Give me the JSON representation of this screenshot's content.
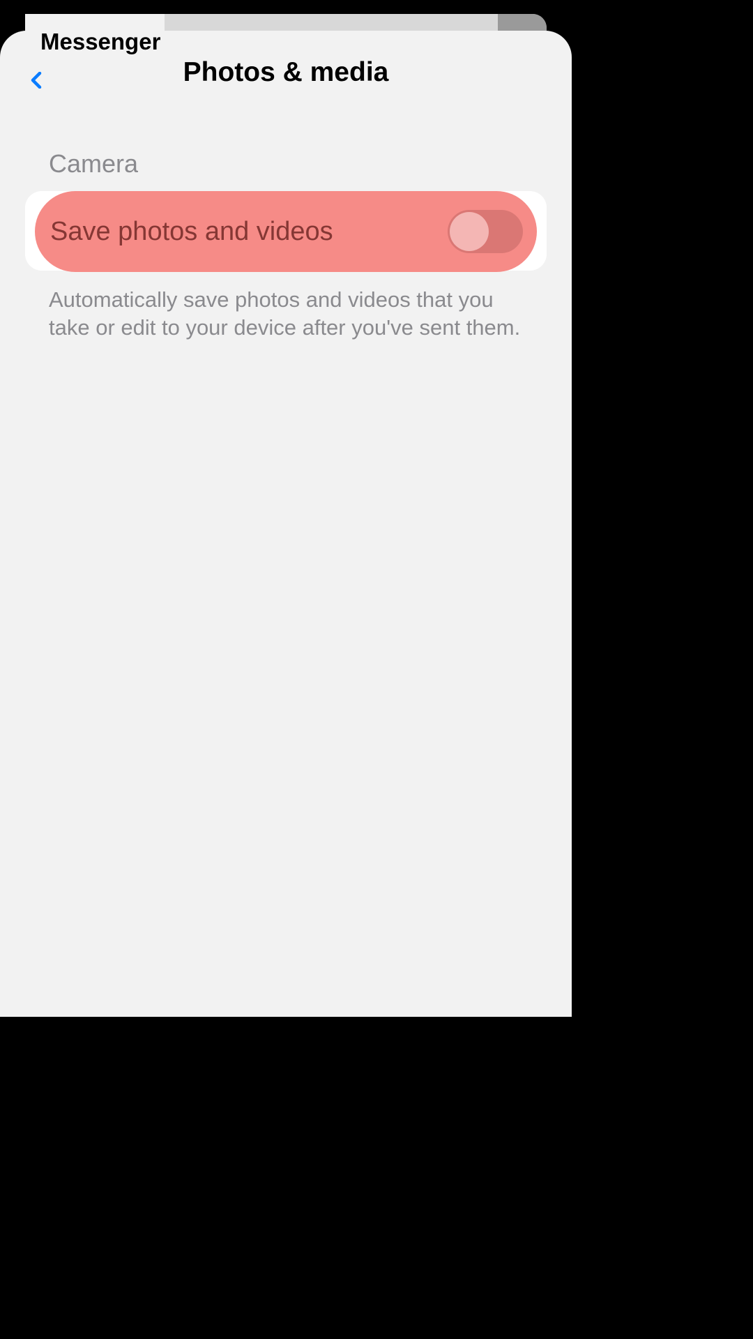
{
  "app_tab": {
    "label": "Messenger"
  },
  "header": {
    "title": "Photos & media"
  },
  "section": {
    "header": "Camera",
    "setting_label": "Save photos and videos",
    "toggle_state": "off",
    "description": "Automatically save photos and videos that you take or edit to your device after you've sent them."
  },
  "colors": {
    "highlight": "#f68b87",
    "accent_blue": "#0a7cff"
  }
}
